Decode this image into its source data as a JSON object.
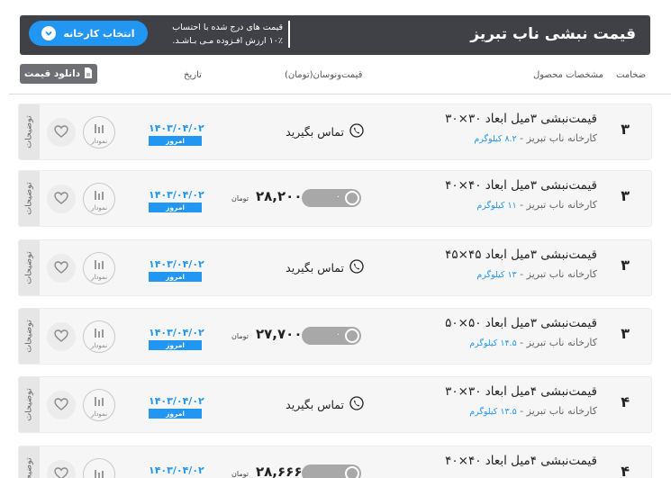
{
  "header": {
    "title": "قیمت نبشی ناب تبریز",
    "note_line1": "قیمت های درج شده با احتساب",
    "note_line2": "۱۰٪ ارزش افـزوده مـی بـاشـد.",
    "factory_button": "انتخاب کارخانه"
  },
  "columns": {
    "thickness": "ضخامت",
    "specs": "مشخصات محصول",
    "price": "قیمت‌ونوسان(تومان)",
    "date": "تاریخ"
  },
  "download_button": "دانلود قیمت",
  "rows": [
    {
      "name": "قیمت‌نبشی ۳میل ابعاد ۳۰×۳۰",
      "factory": "کارخانه ناب تبریز - ",
      "weight": "۸.۲ کیلوگرم",
      "thickness": "۳",
      "date": "۱۴۰۳/۰۴/۰۲",
      "today": "امروز",
      "contact": "تماس بگیرید",
      "price": null,
      "unit": null,
      "toggle_value": null,
      "chart_label": "نمودار",
      "side_tab": "توضیحات"
    },
    {
      "name": "قیمت‌نبشی ۳میل ابعاد ۴۰×۴۰",
      "factory": "کارخانه ناب تبریز - ",
      "weight": "۱۱ کیلوگرم",
      "thickness": "۳",
      "date": "۱۴۰۳/۰۴/۰۲",
      "today": "امروز",
      "contact": null,
      "price": "۲۸,۲۰۰",
      "unit": "تومان",
      "toggle_value": "۰",
      "chart_label": "نمودار",
      "side_tab": "توضیحات"
    },
    {
      "name": "قیمت‌نبشی ۳میل ابعاد ۴۵×۴۵",
      "factory": "کارخانه ناب تبریز - ",
      "weight": "۱۳ کیلوگرم",
      "thickness": "۳",
      "date": "۱۴۰۳/۰۴/۰۲",
      "today": "امروز",
      "contact": "تماس بگیرید",
      "price": null,
      "unit": null,
      "toggle_value": null,
      "chart_label": "نمودار",
      "side_tab": "توضیحات"
    },
    {
      "name": "قیمت‌نبشی ۳میل ابعاد ۵۰×۵۰",
      "factory": "کارخانه ناب تبریز - ",
      "weight": "۱۴.۵ کیلوگرم",
      "thickness": "۳",
      "date": "۱۴۰۳/۰۴/۰۲",
      "today": "امروز",
      "contact": null,
      "price": "۲۷,۷۰۰",
      "unit": "تومان",
      "toggle_value": "۰",
      "chart_label": "نمودار",
      "side_tab": "توضیحات"
    },
    {
      "name": "قیمت‌نبشی ۴میل ابعاد ۳۰×۳۰",
      "factory": "کارخانه ناب تبریز - ",
      "weight": "۱۳.۵ کیلوگرم",
      "thickness": "۴",
      "date": "۱۴۰۳/۰۴/۰۲",
      "today": "امروز",
      "contact": "تماس بگیرید",
      "price": null,
      "unit": null,
      "toggle_value": null,
      "chart_label": "نمودار",
      "side_tab": "توضیحات"
    },
    {
      "name": "قیمت‌نبشی ۴میل ابعاد ۴۰×۴۰",
      "factory": "",
      "weight": "",
      "thickness": "۴",
      "date": "۱۴۰۳/۰۴/۰۲",
      "today": "",
      "contact": null,
      "price": "۲۸,۶۶۶",
      "unit": "تومان",
      "toggle_value": "",
      "chart_label": "",
      "side_tab": "توضیحات"
    }
  ]
}
